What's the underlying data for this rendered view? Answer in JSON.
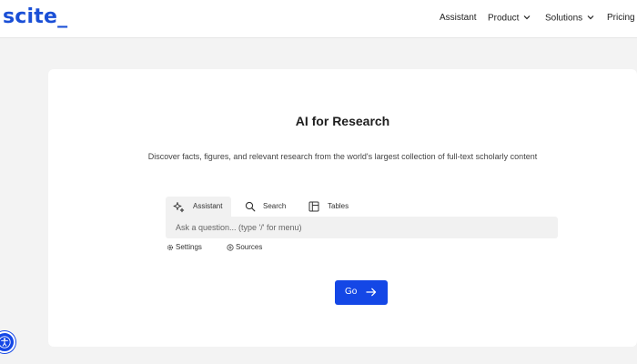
{
  "header": {
    "logo": "scite_",
    "nav": [
      {
        "label": "Assistant",
        "has_dropdown": false
      },
      {
        "label": "Product",
        "has_dropdown": true
      },
      {
        "label": "Solutions",
        "has_dropdown": true
      },
      {
        "label": "Pricing",
        "has_dropdown": false
      }
    ]
  },
  "hero": {
    "title": "AI for Research",
    "subtitle": "Discover facts, figures, and relevant research from the world's largest collection of full-text scholarly content"
  },
  "tabs": [
    {
      "label": "Assistant",
      "icon": "sparkle-icon",
      "active": true
    },
    {
      "label": "Search",
      "icon": "search-icon",
      "active": false
    },
    {
      "label": "Tables",
      "icon": "table-icon",
      "active": false
    }
  ],
  "query": {
    "value": "",
    "placeholder": "Ask a question... (type '/' for menu)"
  },
  "options": {
    "settings_label": "Settings",
    "sources_label": "Sources"
  },
  "go_button": {
    "label": "Go"
  },
  "colors": {
    "brand": "#1a4fd6",
    "button": "#1447e6",
    "page_bg": "#f3f3f3",
    "card_bg": "#ffffff"
  }
}
